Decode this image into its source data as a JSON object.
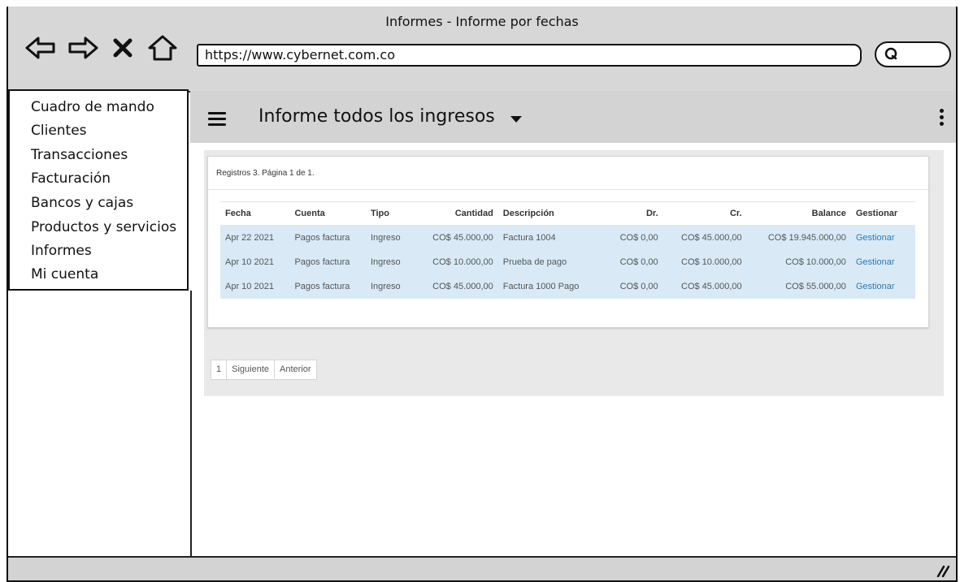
{
  "window": {
    "title": "Informes - Informe por fechas"
  },
  "browser": {
    "url": "https://www.cybernet.com.co"
  },
  "icons": {
    "back": "back-arrow-icon",
    "forward": "forward-arrow-icon",
    "stop": "close-icon",
    "home": "home-icon",
    "search": "search-icon",
    "menu": "hamburger-icon",
    "dropdown": "caret-down-icon",
    "more": "more-vertical-icon",
    "resize": "resize-grip-icon"
  },
  "sidebar": {
    "items": [
      {
        "label": "Cuadro de mando"
      },
      {
        "label": "Clientes"
      },
      {
        "label": "Transacciones"
      },
      {
        "label": "Facturación"
      },
      {
        "label": "Bancos y cajas"
      },
      {
        "label": "Productos y servicios"
      },
      {
        "label": "Informes"
      },
      {
        "label": "Mi cuenta"
      }
    ]
  },
  "header": {
    "title": "Informe todos los ingresos"
  },
  "report": {
    "records_text": "Registros 3. Página 1 de 1.",
    "columns": [
      "Fecha",
      "Cuenta",
      "Tipo",
      "Cantidad",
      "Descripción",
      "Dr.",
      "Cr.",
      "Balance",
      "Gestionar"
    ],
    "rows": [
      [
        "Apr 22 2021",
        "Pagos factura",
        "Ingreso",
        "CO$ 45.000,00",
        "Factura 1004",
        "CO$ 0,00",
        "CO$ 45.000,00",
        "CO$ 19.945.000,00",
        "Gestionar"
      ],
      [
        "Apr 10 2021",
        "Pagos factura",
        "Ingreso",
        "CO$ 10.000,00",
        "Prueba de pago",
        "CO$ 0,00",
        "CO$ 10.000,00",
        "CO$ 10.000,00",
        "Gestionar"
      ],
      [
        "Apr 10 2021",
        "Pagos factura",
        "Ingreso",
        "CO$ 45.000,00",
        "Factura 1000 Pago",
        "CO$ 0,00",
        "CO$ 45.000,00",
        "CO$ 55.000,00",
        "Gestionar"
      ]
    ]
  },
  "pagination": {
    "current": "1",
    "next": "Siguiente",
    "prev": "Anterior"
  },
  "colors": {
    "row_highlight": "#d9eaf6",
    "link": "#2a7ab8",
    "chrome": "#d7d7d7"
  }
}
